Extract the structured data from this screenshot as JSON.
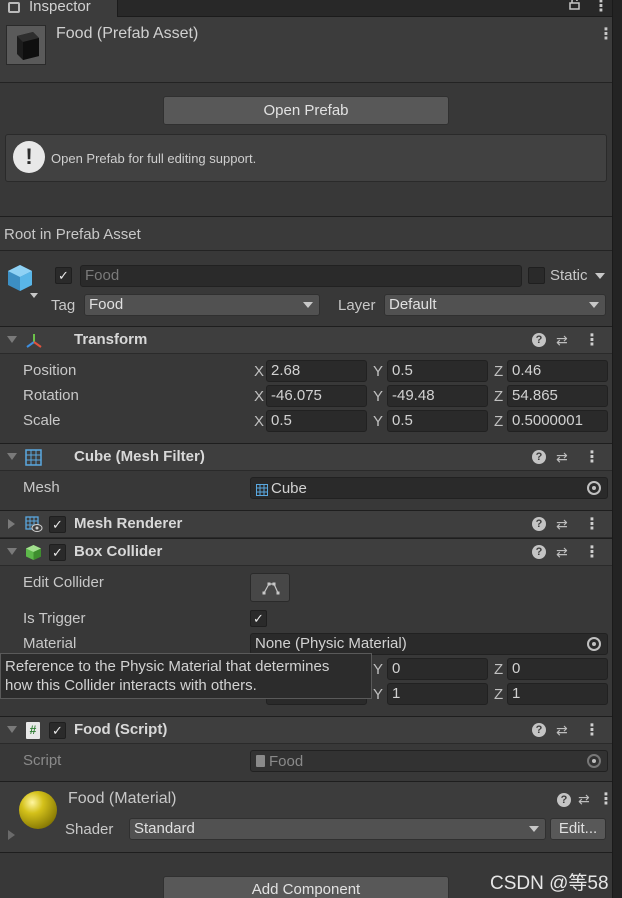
{
  "tab": {
    "title": "Inspector"
  },
  "asset": {
    "name": "Food (Prefab Asset)"
  },
  "open_prefab": {
    "label": "Open Prefab"
  },
  "info": {
    "text": "Open Prefab for full editing support."
  },
  "root_label": "Root in Prefab Asset",
  "gameobject": {
    "name_placeholder": "Food",
    "static_label": "Static",
    "tag_label": "Tag",
    "tag_value": "Food",
    "layer_label": "Layer",
    "layer_value": "Default"
  },
  "transform": {
    "title": "Transform",
    "rows": [
      {
        "label": "Position",
        "x": "2.68",
        "y": "0.5",
        "z": "0.46"
      },
      {
        "label": "Rotation",
        "x": "-46.075",
        "y": "-49.48",
        "z": "54.865"
      },
      {
        "label": "Scale",
        "x": "0.5",
        "y": "0.5",
        "z": "0.5000001"
      }
    ]
  },
  "axis": {
    "x": "X",
    "y": "Y",
    "z": "Z"
  },
  "mesh_filter": {
    "title": "Cube (Mesh Filter)",
    "mesh_label": "Mesh",
    "mesh_value": "Cube"
  },
  "mesh_renderer": {
    "title": "Mesh Renderer"
  },
  "box_collider": {
    "title": "Box Collider",
    "edit_label": "Edit Collider",
    "trigger_label": "Is Trigger",
    "material_label": "Material",
    "material_value": "None (Physic Material)",
    "center_y": "0",
    "center_z": "0",
    "size_y": "1",
    "size_z": "1"
  },
  "tooltip": {
    "line1": "Reference to the Physic Material that determines",
    "line2": "how this Collider interacts with others."
  },
  "script_comp": {
    "title": "Food (Script)",
    "script_label": "Script",
    "script_value": "Food"
  },
  "material": {
    "title": "Food (Material)",
    "shader_label": "Shader",
    "shader_value": "Standard",
    "edit_label": "Edit..."
  },
  "add_component": {
    "label": "Add Component"
  },
  "watermark": "CSDN @等58",
  "colors": {
    "panel": "#383838",
    "field": "#2a2a2a",
    "header": "#3e3e3e",
    "accent_cube": "#59b6e8"
  }
}
